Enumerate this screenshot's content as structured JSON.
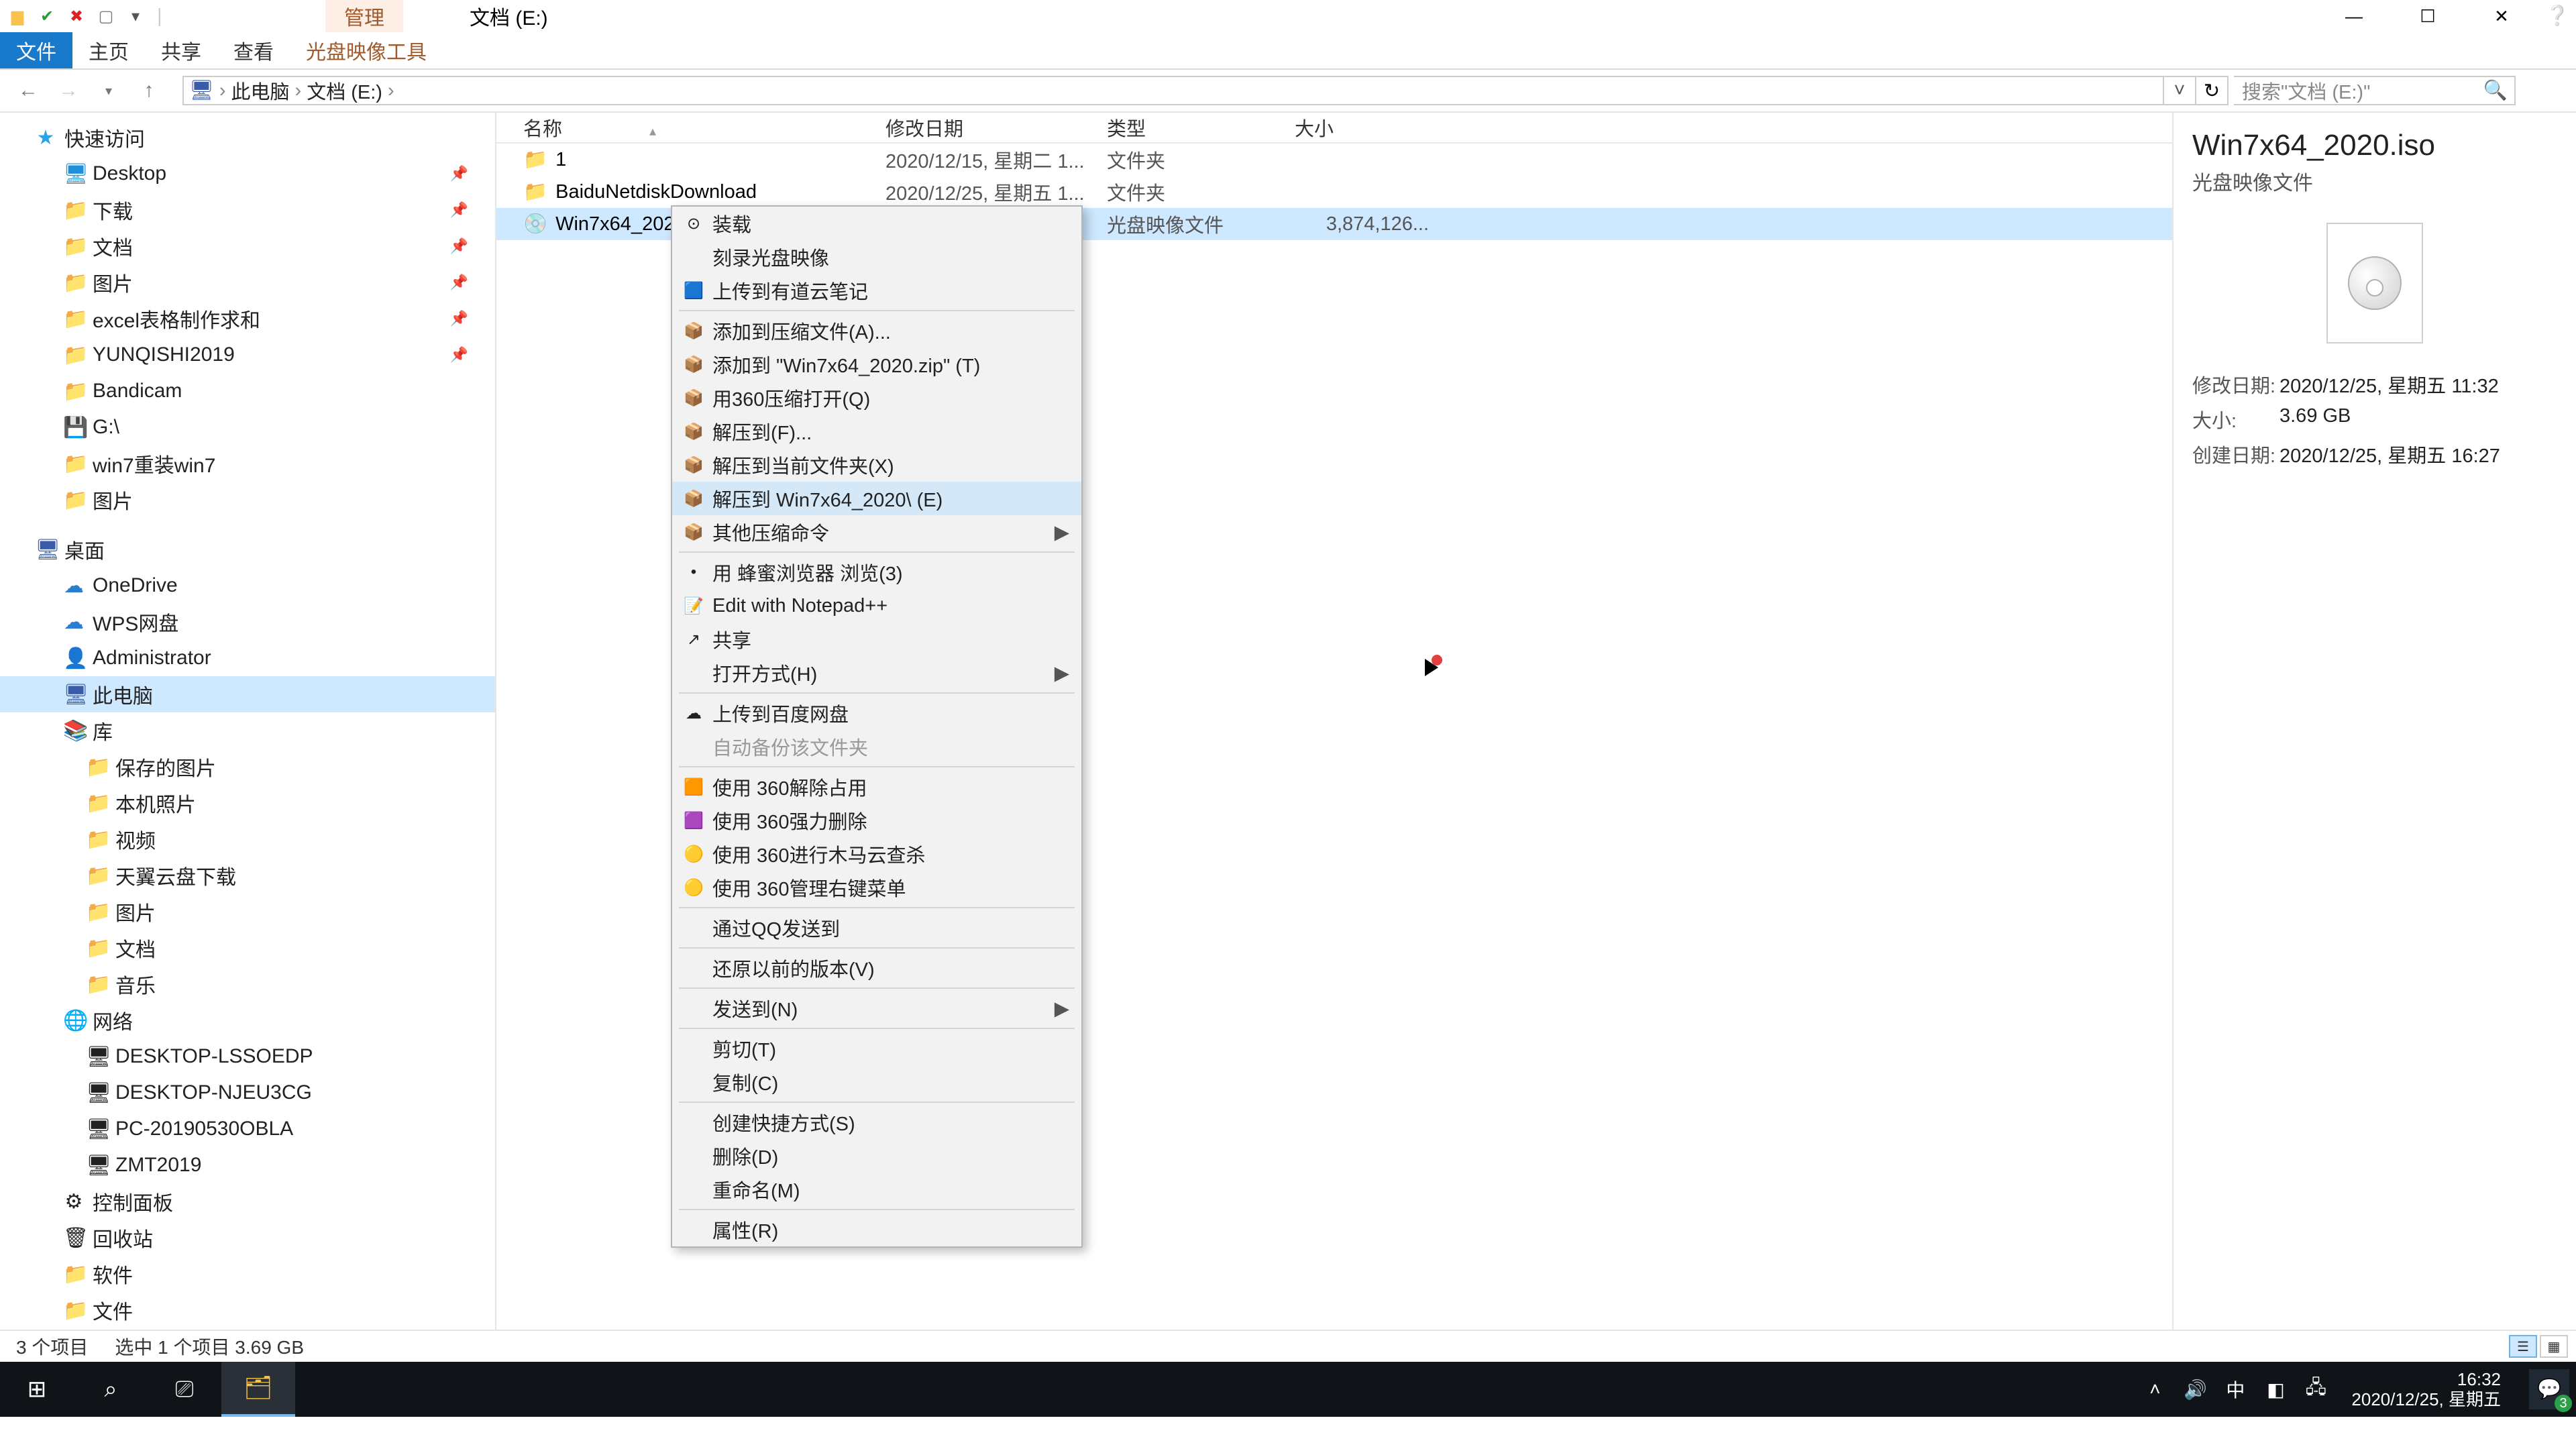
{
  "title": {
    "manage": "管理",
    "path": "文档 (E:)"
  },
  "ribbon": {
    "file": "文件",
    "home": "主页",
    "share": "共享",
    "view": "查看",
    "tool": "光盘映像工具"
  },
  "nav": {
    "back": "←",
    "fwd": "→",
    "up": "↑"
  },
  "crumbs": [
    "此电脑",
    "文档 (E:)"
  ],
  "search_placeholder": "搜索\"文档 (E:)\"",
  "tree": {
    "quick": "快速访问",
    "quick_items": [
      {
        "label": "Desktop",
        "ico": "🖥",
        "blue": true,
        "pin": true
      },
      {
        "label": "下载",
        "ico": "📁",
        "blue": true,
        "pin": true
      },
      {
        "label": "文档",
        "ico": "📁",
        "blue": true,
        "pin": true
      },
      {
        "label": "图片",
        "ico": "📁",
        "blue": true,
        "pin": true
      },
      {
        "label": "excel表格制作求和",
        "ico": "📁",
        "pin": true
      },
      {
        "label": "YUNQISHI2019",
        "ico": "📁",
        "pin": true
      },
      {
        "label": "Bandicam",
        "ico": "📁"
      },
      {
        "label": "G:\\",
        "ico": "💾"
      },
      {
        "label": "win7重装win7",
        "ico": "📁"
      },
      {
        "label": "图片",
        "ico": "📁"
      }
    ],
    "desktop": "桌面",
    "desktop_items": [
      {
        "label": "OneDrive",
        "ico": "☁",
        "cls": "net"
      },
      {
        "label": "WPS网盘",
        "ico": "☁",
        "cls": "net"
      },
      {
        "label": "Administrator",
        "ico": "👤"
      },
      {
        "label": "此电脑",
        "ico": "🖥",
        "cls": "mon",
        "sel": true
      },
      {
        "label": "库",
        "ico": "📚"
      }
    ],
    "lib_items": [
      {
        "label": "保存的图片",
        "ico": "📁"
      },
      {
        "label": "本机照片",
        "ico": "📁"
      },
      {
        "label": "视频",
        "ico": "📁"
      },
      {
        "label": "天翼云盘下载",
        "ico": "📁"
      },
      {
        "label": "图片",
        "ico": "📁"
      },
      {
        "label": "文档",
        "ico": "📁"
      },
      {
        "label": "音乐",
        "ico": "📁"
      }
    ],
    "network": "网络",
    "net_items": [
      {
        "label": "DESKTOP-LSSOEDP",
        "ico": "🖥"
      },
      {
        "label": "DESKTOP-NJEU3CG",
        "ico": "🖥"
      },
      {
        "label": "PC-20190530OBLA",
        "ico": "🖥"
      },
      {
        "label": "ZMT2019",
        "ico": "🖥"
      }
    ],
    "misc": [
      {
        "label": "控制面板",
        "ico": "⚙"
      },
      {
        "label": "回收站",
        "ico": "🗑"
      },
      {
        "label": "软件",
        "ico": "📁"
      },
      {
        "label": "文件",
        "ico": "📁"
      }
    ]
  },
  "cols": {
    "name": "名称",
    "date": "修改日期",
    "type": "类型",
    "size": "大小"
  },
  "rows": [
    {
      "name": "1",
      "date": "2020/12/15, 星期二 1...",
      "type": "文件夹",
      "size": "",
      "ico": "📁"
    },
    {
      "name": "BaiduNetdiskDownload",
      "date": "2020/12/25, 星期五 1...",
      "type": "文件夹",
      "size": "",
      "ico": "📁"
    },
    {
      "name": "Win7x64_2020.iso",
      "date": "2020/12/25, 星期五 1...",
      "type": "光盘映像文件",
      "size": "3,874,126...",
      "ico": "💿",
      "sel": true
    }
  ],
  "ctx": [
    {
      "t": "装载",
      "ico": "⊙"
    },
    {
      "t": "刻录光盘映像"
    },
    {
      "t": "上传到有道云笔记",
      "ico": "🟦"
    },
    {
      "sep": true
    },
    {
      "t": "添加到压缩文件(A)...",
      "ico": "📦"
    },
    {
      "t": "添加到 \"Win7x64_2020.zip\" (T)",
      "ico": "📦"
    },
    {
      "t": "用360压缩打开(Q)",
      "ico": "📦"
    },
    {
      "t": "解压到(F)...",
      "ico": "📦"
    },
    {
      "t": "解压到当前文件夹(X)",
      "ico": "📦"
    },
    {
      "t": "解压到 Win7x64_2020\\ (E)",
      "ico": "📦",
      "hover": true
    },
    {
      "t": "其他压缩命令",
      "ico": "📦",
      "arrow": true
    },
    {
      "sep": true
    },
    {
      "t": "用 蜂蜜浏览器 浏览(3)",
      "ico": "•"
    },
    {
      "t": "Edit with Notepad++",
      "ico": "📝"
    },
    {
      "t": "共享",
      "ico": "↗"
    },
    {
      "t": "打开方式(H)",
      "arrow": true
    },
    {
      "sep": true
    },
    {
      "t": "上传到百度网盘",
      "ico": "☁"
    },
    {
      "t": "自动备份该文件夹",
      "disabled": true
    },
    {
      "sep": true
    },
    {
      "t": "使用 360解除占用",
      "ico": "🟧"
    },
    {
      "t": "使用 360强力删除",
      "ico": "🟪"
    },
    {
      "t": "使用 360进行木马云查杀",
      "ico": "🟡"
    },
    {
      "t": "使用 360管理右键菜单",
      "ico": "🟡"
    },
    {
      "sep": true
    },
    {
      "t": "通过QQ发送到"
    },
    {
      "sep": true
    },
    {
      "t": "还原以前的版本(V)"
    },
    {
      "sep": true
    },
    {
      "t": "发送到(N)",
      "arrow": true
    },
    {
      "sep": true
    },
    {
      "t": "剪切(T)"
    },
    {
      "t": "复制(C)"
    },
    {
      "sep": true
    },
    {
      "t": "创建快捷方式(S)"
    },
    {
      "t": "删除(D)"
    },
    {
      "t": "重命名(M)"
    },
    {
      "sep": true
    },
    {
      "t": "属性(R)"
    }
  ],
  "details": {
    "title": "Win7x64_2020.iso",
    "sub": "光盘映像文件",
    "meta": [
      {
        "k": "修改日期:",
        "v": "2020/12/25, 星期五 11:32"
      },
      {
        "k": "大小:",
        "v": "3.69 GB"
      },
      {
        "k": "创建日期:",
        "v": "2020/12/25, 星期五 16:27"
      }
    ]
  },
  "status": {
    "a": "3 个项目",
    "b": "选中 1 个项目  3.69 GB"
  },
  "taskbar": {
    "time": "16:32",
    "date": "2020/12/25, 星期五",
    "ime": "中",
    "badge": "3"
  }
}
